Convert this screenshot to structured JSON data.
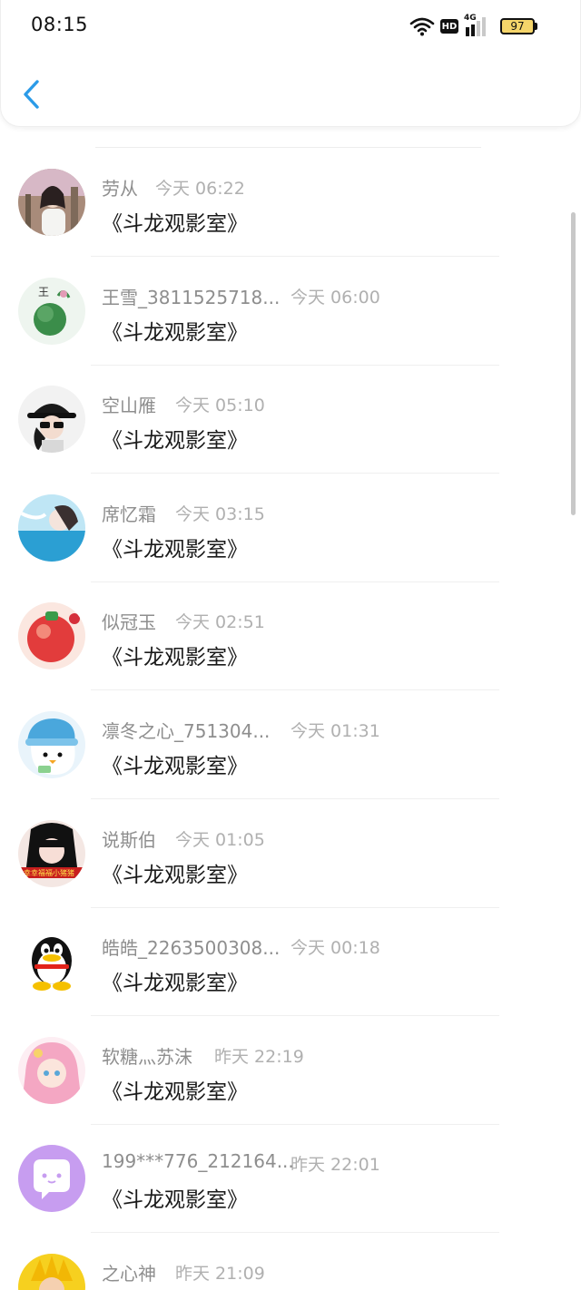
{
  "status_bar": {
    "time": "08:15",
    "network_badge": "HD",
    "signal_type": "4G",
    "battery": "97"
  },
  "colors": {
    "accent": "#2b9be8",
    "name_gray": "#8e8e8e",
    "time_gray": "#b0b0b0"
  },
  "messages": [
    {
      "name": "劳从",
      "time": "今天 06:22",
      "message": "《斗龙观影室》"
    },
    {
      "name": "王雪_3811525718...",
      "time": "今天 06:00",
      "message": "《斗龙观影室》"
    },
    {
      "name": "空山雁",
      "time": "今天 05:10",
      "message": "《斗龙观影室》"
    },
    {
      "name": "席忆霜",
      "time": "今天 03:15",
      "message": "《斗龙观影室》"
    },
    {
      "name": "似冠玉",
      "time": "今天 02:51",
      "message": "《斗龙观影室》"
    },
    {
      "name": "凛冬之心_751304...",
      "time": "今天 01:31",
      "message": "《斗龙观影室》"
    },
    {
      "name": "说斯伯",
      "time": "今天 01:05",
      "message": "《斗龙观影室》"
    },
    {
      "name": "皓皓_2263500308...",
      "time": "今天 00:18",
      "message": "《斗龙观影室》"
    },
    {
      "name": "软糖灬苏沫",
      "time": "昨天 22:19",
      "message": "《斗龙观影室》"
    },
    {
      "name": "199***776_212164...",
      "time": "昨天 22:01",
      "message": "《斗龙观影室》"
    },
    {
      "name": "之心神",
      "time": "昨天 21:09",
      "message": ""
    }
  ]
}
